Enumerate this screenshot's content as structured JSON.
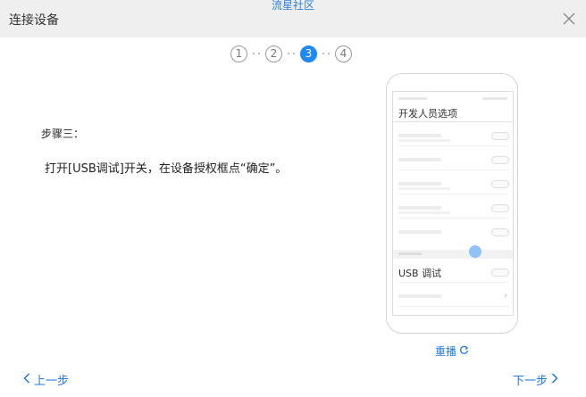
{
  "window": {
    "title": "连接设备",
    "brand": "流星社区",
    "close_icon": "close-icon"
  },
  "stepper": {
    "steps": [
      "1",
      "2",
      "3",
      "4"
    ],
    "active": 3
  },
  "content": {
    "step_label": "步骤三：",
    "instruction": "打开[USB调试]开关，在设备授权框点“确定”。"
  },
  "phone": {
    "screen_title": "开发人员选项",
    "usb_label": "USB 调试"
  },
  "replay": {
    "label": "重播",
    "icon": "refresh-icon"
  },
  "nav": {
    "prev_label": "上一步",
    "next_label": "下一步"
  },
  "colors": {
    "accent": "#1e88f5",
    "titlebar": "#efefef"
  }
}
